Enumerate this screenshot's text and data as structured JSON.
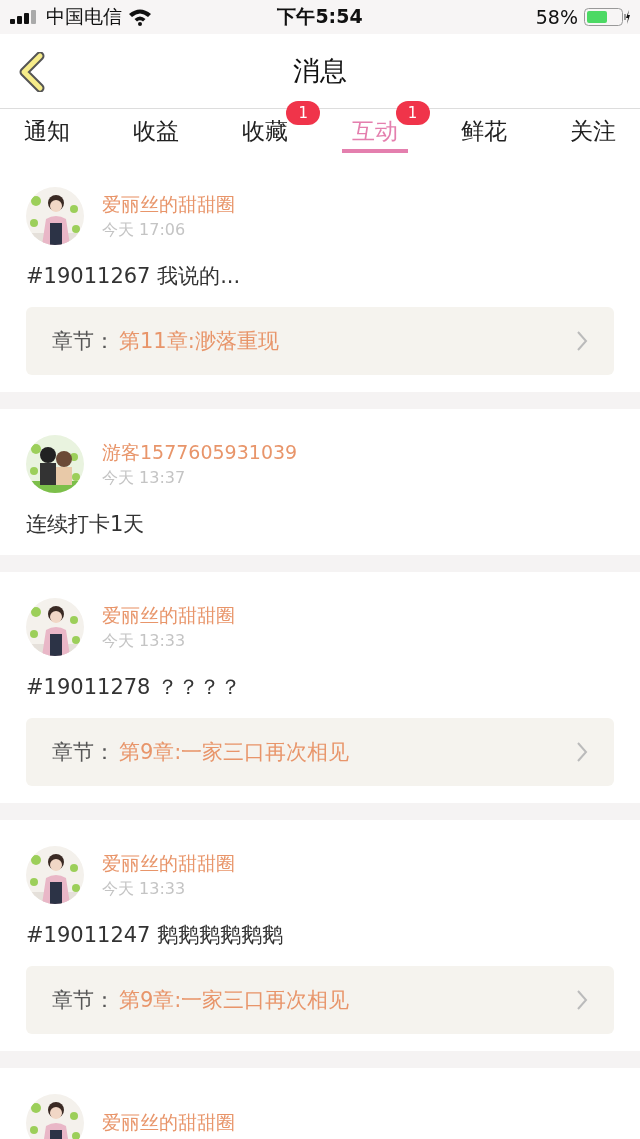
{
  "status_bar": {
    "carrier": "中国电信",
    "time": "下午5:54",
    "battery": "58%"
  },
  "nav": {
    "title": "消息"
  },
  "tabs": [
    {
      "label": "通知",
      "selected": false
    },
    {
      "label": "收益",
      "selected": false
    },
    {
      "label": "收藏",
      "selected": false,
      "badge": "1"
    },
    {
      "label": "互动",
      "selected": true,
      "badge": "1"
    },
    {
      "label": "鲜花",
      "selected": false
    },
    {
      "label": "关注",
      "selected": false
    }
  ],
  "messages": [
    {
      "user": "爱丽丝的甜甜圈",
      "time": "今天 17:06",
      "text": "#19011267 我说的...",
      "chapter_label": "章节：",
      "chapter": "第11章:渺落重现"
    },
    {
      "user": "游客1577605931039",
      "time": "今天 13:37",
      "text": "连续打卡1天"
    },
    {
      "user": "爱丽丝的甜甜圈",
      "time": "今天 13:33",
      "text": "#19011278 ？？？？",
      "chapter_label": "章节：",
      "chapter": "第9章:一家三口再次相见"
    },
    {
      "user": "爱丽丝的甜甜圈",
      "time": "今天 13:33",
      "text": "#19011247 鹅鹅鹅鹅鹅鹅",
      "chapter_label": "章节：",
      "chapter": "第9章:一家三口再次相见"
    },
    {
      "user": "爱丽丝的甜甜圈"
    }
  ]
}
